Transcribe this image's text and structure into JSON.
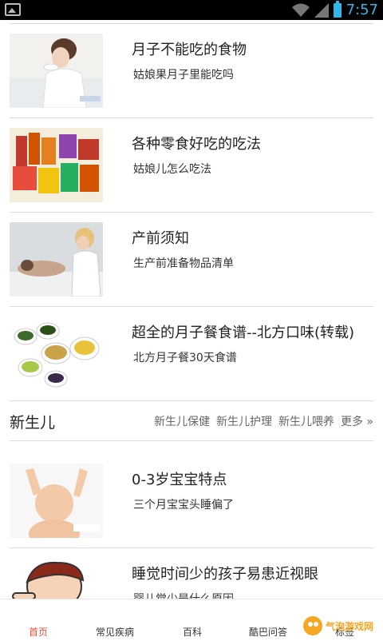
{
  "status_bar": {
    "time": "7:57"
  },
  "articles": [
    {
      "title": "月子不能吃的食物",
      "subtitle": "姑娘果月子里能吃吗",
      "image": "mother-eating-photo"
    },
    {
      "title": "各种零食好吃的吃法",
      "subtitle": "姑娘儿怎么吃法",
      "image": "snacks-photo"
    },
    {
      "title": "产前须知",
      "subtitle": "生产前准备物品清单",
      "image": "prenatal-exam-photo"
    },
    {
      "title": "超全的月子餐食谱--北方口味(转载)",
      "subtitle": "北方月子餐30天食谱",
      "image": "soup-bowls-photo"
    }
  ],
  "section": {
    "title": "新生儿",
    "tags": [
      "新生儿保健",
      "新生儿护理",
      "新生儿喂养"
    ],
    "more": "更多 »"
  },
  "section_articles": [
    {
      "title": "0-3岁宝宝特点",
      "subtitle": "三个月宝宝头睡偏了",
      "image": "baby-photo"
    },
    {
      "title": "睡觉时间少的孩子易患近视眼",
      "subtitle": "婴儿觉少是什么原因",
      "image": "cartoon-boy-illustration"
    }
  ],
  "bottom_nav": [
    {
      "label": "首页",
      "active": true
    },
    {
      "label": "常见疾病",
      "active": false
    },
    {
      "label": "百科",
      "active": false
    },
    {
      "label": "酷巴问答",
      "active": false
    },
    {
      "label": "标签",
      "active": false
    }
  ],
  "watermark": "气泡游戏网"
}
